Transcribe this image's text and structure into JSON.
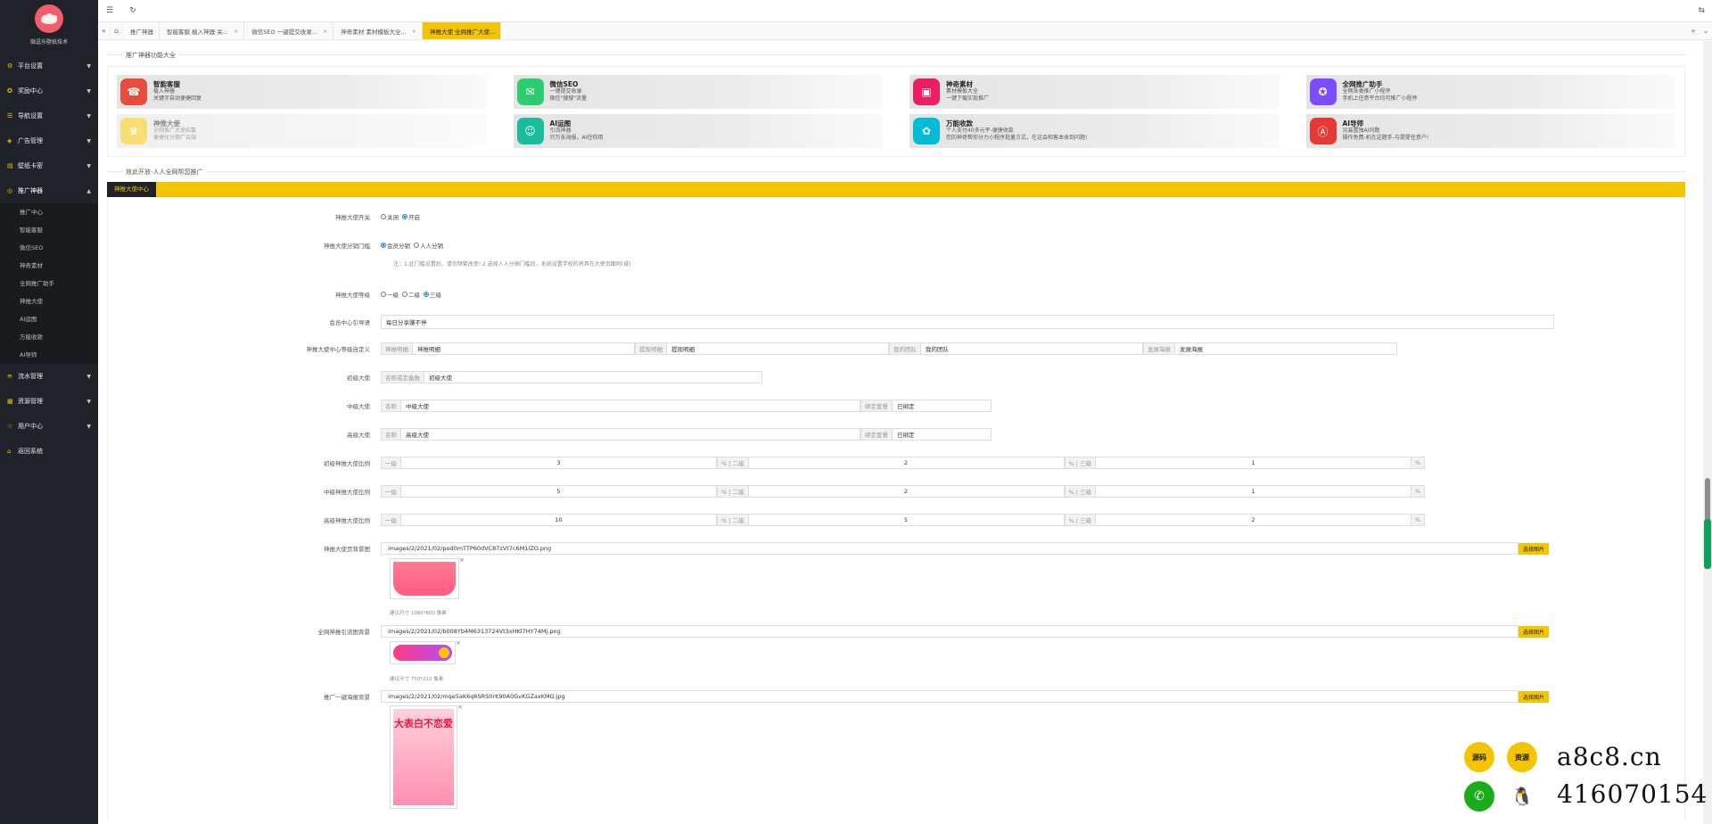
{
  "app": {
    "logo_caption": "微逗乐壁纸技术"
  },
  "sidebar": {
    "items": [
      {
        "label": "平台设置"
      },
      {
        "label": "奖励中心"
      },
      {
        "label": "导航设置"
      },
      {
        "label": "广告管理"
      },
      {
        "label": "壁纸卡密"
      },
      {
        "label": "推广神器"
      },
      {
        "label": "流水管理"
      },
      {
        "label": "资源管理"
      },
      {
        "label": "用户中心"
      },
      {
        "label": "返回系统"
      }
    ],
    "submenu": [
      {
        "label": "推广中心"
      },
      {
        "label": "智能客服"
      },
      {
        "label": "微信SEO"
      },
      {
        "label": "神奇素材"
      },
      {
        "label": "全网推广助手"
      },
      {
        "label": "神推大使"
      },
      {
        "label": "AI运图"
      },
      {
        "label": "万能收款"
      },
      {
        "label": "AI导师"
      }
    ]
  },
  "tabs": [
    {
      "label": "推广神器"
    },
    {
      "label": "智能客服 植入神器 关..."
    },
    {
      "label": "微信SEO 一键提交收录..."
    },
    {
      "label": "神奇素材 素材模板大全..."
    },
    {
      "label": "神推大使 全网推广大使..."
    }
  ],
  "section1": {
    "title": "推广神器功能大全"
  },
  "cards": [
    {
      "title": "智能客服",
      "desc1": "植入神器",
      "desc2": "关键字自动便捷回复",
      "color": "#e74c3c",
      "icon": "headset-icon",
      "glyph": "☎"
    },
    {
      "title": "微信SEO",
      "desc1": "一键提交收录",
      "desc2": "微信\"搜搜\"流量",
      "color": "#2ecc71",
      "icon": "wechat-icon",
      "glyph": "✉"
    },
    {
      "title": "神奇素材",
      "desc1": "素材模板大全",
      "desc2": "一键下载实现推广",
      "color": "#e91e63",
      "icon": "material-icon",
      "glyph": "▣"
    },
    {
      "title": "全网推广助手",
      "desc1": "全网各类推广小程序",
      "desc2": "手机上任意平台均可推广小程序",
      "color": "#7c4dff",
      "icon": "bulb-icon",
      "glyph": "✪"
    },
    {
      "title": "神推大使",
      "desc1": "全网推广大使招募",
      "desc2": "便捷化分佣广告端",
      "color": "#f5c400",
      "icon": "ambassador-icon",
      "glyph": "♛",
      "faded": true
    },
    {
      "title": "AI运图",
      "desc1": "引流神器",
      "desc2": "只万张海报，AI任你用",
      "color": "#1abc9c",
      "icon": "smile-icon",
      "glyph": "☺"
    },
    {
      "title": "万能收款",
      "desc1": "个人支付40多元平-便捷收款",
      "desc2": "您的神奇帮你分力小程序批量方式，在这会和客本收到问题!",
      "color": "#00bcd4",
      "icon": "payment-icon",
      "glyph": "✿"
    },
    {
      "title": "AI导师",
      "desc1": "另装置独AI问题",
      "desc2": "操作免费-机在这题手-与提提任意户!",
      "color": "#e53935",
      "icon": "ai-icon",
      "glyph": "Ⓐ"
    }
  ],
  "section2": {
    "title": "效此开放-人人全网帮您推广"
  },
  "center_tab": "神推大使中心",
  "form": {
    "switch": {
      "label": "神推大使开关",
      "options": [
        "关闭",
        "开启"
      ],
      "selected": 1
    },
    "threshold": {
      "label": "神推大使分销门槛",
      "options": [
        "会员分销",
        "人人分销"
      ],
      "selected": 0,
      "note": "注：1.此门槛设置后，请勿频繁改变! 2.选择人人分销门槛后，系统设置学校的将具在大使页面同(城)"
    },
    "level": {
      "label": "神推大使等级",
      "options": [
        "一级",
        "二级",
        "三级"
      ],
      "selected": 2
    },
    "center_title": {
      "label": "会员中心引导语",
      "value": "每日分享赚不停"
    },
    "custom_center": {
      "label": "神推大使中心等级自定义",
      "fields": [
        {
          "addon": "神推明细",
          "value": "神推明细"
        },
        {
          "addon": "提现明细",
          "value": "提现明细"
        },
        {
          "addon": "我的团队",
          "value": "我的团队"
        },
        {
          "addon": "发展海报",
          "value": "发展海报"
        }
      ]
    },
    "junior": {
      "label": "初级大使",
      "addon": "名称或定备数",
      "value": "初级大使"
    },
    "middle": {
      "label": "中级大使",
      "addon": "名称",
      "value": "中级大使",
      "addon2": "绑定套餐",
      "value2": "已绑定"
    },
    "senior": {
      "label": "高级大使",
      "addon": "名称",
      "value": "高级大使",
      "addon2": "绑定套餐",
      "value2": "已绑定"
    },
    "ratios": [
      {
        "label": "初级神推大使比例",
        "l1": "3",
        "l2": "2",
        "l3": "1"
      },
      {
        "label": "中级神推大使比例",
        "l1": "5",
        "l2": "2",
        "l3": "1"
      },
      {
        "label": "高级神推大使比例",
        "l1": "10",
        "l2": "5",
        "l3": "2"
      }
    ],
    "ratio_labels": {
      "first": "一级",
      "second": "% | 二级",
      "third": "% | 三级",
      "pct": "%"
    },
    "images": [
      {
        "label": "神推大使页背景图",
        "path": "images/2/2021/02/pod0mTTP60dVC87zVt7c6M1IZO.png",
        "hint": "建议尺寸 1080*800 像素"
      },
      {
        "label": "全网神推引流图背景",
        "path": "images/2/2021/02/b008Yb4M6313724Vt3xHKl7HY74Mj.png",
        "hint": "建议尺寸 750*210 像素"
      },
      {
        "label": "推广一键海报背景",
        "path": "images/2/2021/02/mqe5aK6q6SRS0rK90A0GvKGZaxKMG.jpg",
        "hint": ""
      }
    ],
    "pick_button": "选择图片",
    "poster_text": "大表白不恋爱"
  },
  "watermark": {
    "site": "a8c8.cn",
    "qq": "416070154",
    "badge1": "源码",
    "badge2": "资源"
  },
  "colors": {
    "accent": "#f5c400",
    "sidebar": "#1f2329",
    "wechat": "#1aad19"
  }
}
